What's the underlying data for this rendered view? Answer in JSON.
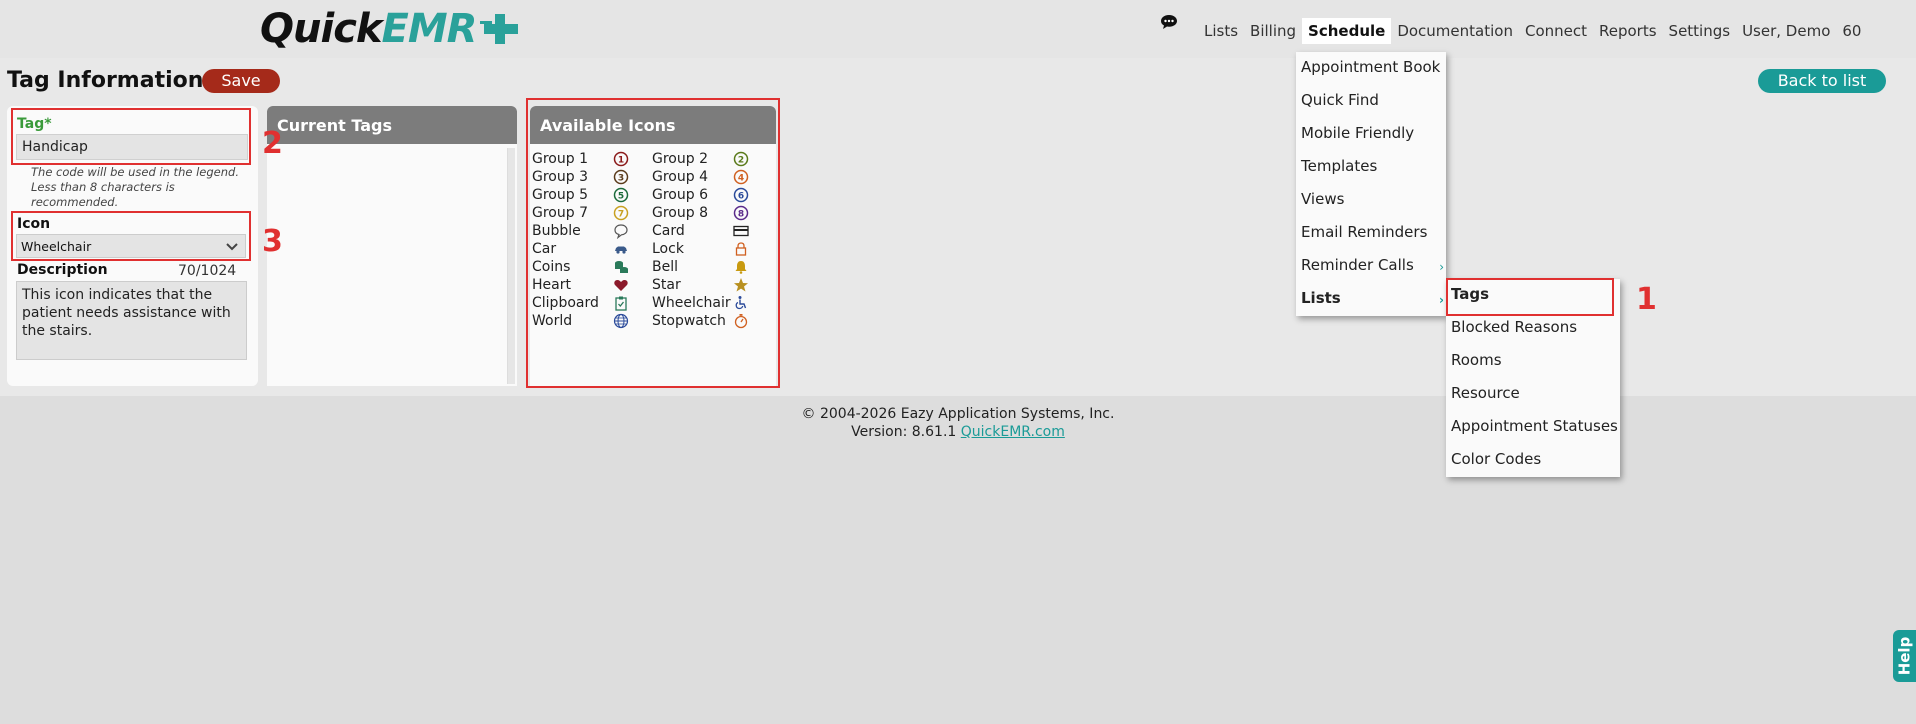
{
  "header": {
    "logo": {
      "quick": "Quick",
      "emr": "EMR"
    },
    "nav": [
      {
        "label": "Lists",
        "active": false
      },
      {
        "label": "Billing",
        "active": false
      },
      {
        "label": "Schedule",
        "active": true
      },
      {
        "label": "Documentation",
        "active": false
      },
      {
        "label": "Connect",
        "active": false
      },
      {
        "label": "Reports",
        "active": false
      },
      {
        "label": "Settings",
        "active": false
      },
      {
        "label": "User, Demo",
        "active": false
      },
      {
        "label": "60",
        "active": false
      }
    ]
  },
  "page": {
    "title": "Tag Information",
    "save_label": "Save",
    "back_label": "Back to list"
  },
  "form": {
    "tag_label": "Tag*",
    "tag_value": "Handicap",
    "tag_hint": "The code will be used in the legend. Less than 8 characters is recommended.",
    "icon_label": "Icon",
    "icon_value": "Wheelchair",
    "description_label": "Description",
    "description_count": "70/1024",
    "description_value": "This icon indicates that the patient needs assistance with the stairs."
  },
  "current_tags": {
    "title": "Current Tags"
  },
  "available_icons": {
    "title": "Available Icons",
    "rows": [
      [
        {
          "name": "Group 1",
          "icon": "circle-1-icon",
          "color": "#8b1a1a"
        },
        {
          "name": "Group 2",
          "icon": "circle-2-icon",
          "color": "#5a7a1a"
        }
      ],
      [
        {
          "name": "Group 3",
          "icon": "circle-3-icon",
          "color": "#5a3a1a"
        },
        {
          "name": "Group 4",
          "icon": "circle-4-icon",
          "color": "#d06020"
        }
      ],
      [
        {
          "name": "Group 5",
          "icon": "circle-5-icon",
          "color": "#1a6a3a"
        },
        {
          "name": "Group 6",
          "icon": "circle-6-icon",
          "color": "#2a4a9a"
        }
      ],
      [
        {
          "name": "Group 7",
          "icon": "circle-7-icon",
          "color": "#c8a020"
        },
        {
          "name": "Group 8",
          "icon": "circle-8-icon",
          "color": "#5a2a8a"
        }
      ],
      [
        {
          "name": "Bubble",
          "icon": "speech-bubble-icon",
          "color": "#555555"
        },
        {
          "name": "Card",
          "icon": "credit-card-icon",
          "color": "#222222"
        }
      ],
      [
        {
          "name": "Car",
          "icon": "car-icon",
          "color": "#3a5a8a"
        },
        {
          "name": "Lock",
          "icon": "lock-icon",
          "color": "#d06020"
        }
      ],
      [
        {
          "name": "Coins",
          "icon": "coins-icon",
          "color": "#2a7a5a"
        },
        {
          "name": "Bell",
          "icon": "bell-icon",
          "color": "#c89a10"
        }
      ],
      [
        {
          "name": "Heart",
          "icon": "heart-icon",
          "color": "#8b1a2a"
        },
        {
          "name": "Star",
          "icon": "star-icon",
          "color": "#b89020"
        }
      ],
      [
        {
          "name": "Clipboard",
          "icon": "clipboard-icon",
          "color": "#2a7a5a"
        },
        {
          "name": "Wheelchair",
          "icon": "wheelchair-icon",
          "color": "#2a4a9a"
        }
      ],
      [
        {
          "name": "World",
          "icon": "globe-icon",
          "color": "#2a4a9a"
        },
        {
          "name": "Stopwatch",
          "icon": "stopwatch-icon",
          "color": "#d06020"
        }
      ]
    ]
  },
  "schedule_menu": {
    "items": [
      {
        "label": "Appointment Book",
        "submenu": false
      },
      {
        "label": "Quick Find",
        "submenu": false
      },
      {
        "label": "Mobile Friendly",
        "submenu": false
      },
      {
        "label": "Templates",
        "submenu": false
      },
      {
        "label": "Views",
        "submenu": false
      },
      {
        "label": "Email Reminders",
        "submenu": false
      },
      {
        "label": "Reminder Calls",
        "submenu": true
      },
      {
        "label": "Lists",
        "submenu": true,
        "bold": true
      }
    ]
  },
  "lists_submenu": {
    "items": [
      {
        "label": "Tags",
        "bold": true
      },
      {
        "label": "Blocked Reasons"
      },
      {
        "label": "Rooms"
      },
      {
        "label": "Resource"
      },
      {
        "label": "Appointment Statuses"
      },
      {
        "label": "Color Codes"
      }
    ]
  },
  "callouts": {
    "one": "1",
    "two": "2",
    "three": "3"
  },
  "footer": {
    "copyright": "© 2004-2026 Eazy Application Systems, Inc.",
    "version_prefix": "Version: 8.61.1 ",
    "link": "QuickEMR.com"
  },
  "help_label": "Help",
  "colors": {
    "accent": "#1a9b97",
    "save": "#a52a1a",
    "annotation": "#e03030",
    "tag_label": "#3a9a3a"
  }
}
